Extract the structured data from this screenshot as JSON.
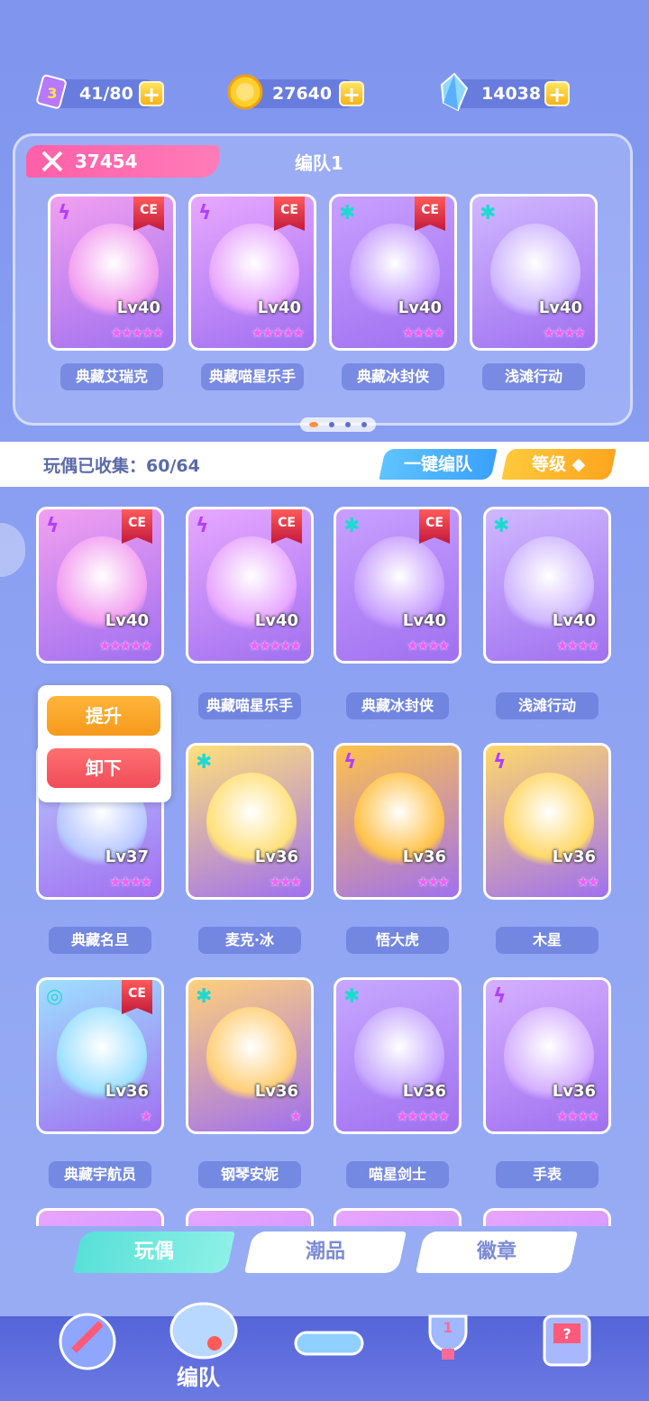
{
  "resources": [
    {
      "icon": "energy-icon",
      "value": "41/80"
    },
    {
      "icon": "coin-icon",
      "value": "27640"
    },
    {
      "icon": "crystal-icon",
      "value": "14038"
    }
  ],
  "team": {
    "power": "37454",
    "name": "编队1",
    "members": [
      {
        "name": "典藏艾瑞克",
        "level": "Lv40",
        "stars": "★★★★★",
        "element": "ϟ",
        "ce": "CE",
        "color": "#f2a0f0"
      },
      {
        "name": "典藏喵星乐手",
        "level": "Lv40",
        "stars": "★★★★★",
        "element": "ϟ",
        "ce": "CE",
        "color": "#e8a8ff"
      },
      {
        "name": "典藏冰封侠",
        "level": "Lv40",
        "stars": "★★★★",
        "element": "✱",
        "ce": "CE",
        "color": "#c8a0ff"
      },
      {
        "name": "浅滩行动",
        "level": "Lv40",
        "stars": "★★★★",
        "element": "✱",
        "ce": "",
        "color": "#d0b8ff"
      }
    ]
  },
  "collection": {
    "label": "玩偶已收集：60/64",
    "btn_quick": "一键编队",
    "btn_sort": "等级 ◆"
  },
  "dolls": [
    {
      "name": "",
      "level": "Lv40",
      "stars": "★★★★★",
      "element": "ϟ",
      "ce": "CE",
      "color": "#f2a0f0"
    },
    {
      "name": "典藏喵星乐手",
      "level": "Lv40",
      "stars": "★★★★★",
      "element": "ϟ",
      "ce": "CE",
      "color": "#e8a8ff"
    },
    {
      "name": "典藏冰封侠",
      "level": "Lv40",
      "stars": "★★★★",
      "element": "✱",
      "ce": "CE",
      "color": "#c8a0ff"
    },
    {
      "name": "浅滩行动",
      "level": "Lv40",
      "stars": "★★★★",
      "element": "✱",
      "ce": "",
      "color": "#d0b8ff"
    },
    {
      "name": "典藏名旦",
      "level": "Lv37",
      "stars": "★★★★",
      "element": "",
      "ce": "",
      "color": "#b8c8ff"
    },
    {
      "name": "麦克·冰",
      "level": "Lv36",
      "stars": "★★★",
      "element": "✱",
      "ce": "",
      "color": "#ffe07a"
    },
    {
      "name": "悟大虎",
      "level": "Lv36",
      "stars": "★★★",
      "element": "ϟ",
      "ce": "",
      "color": "#ffc24a"
    },
    {
      "name": "木星",
      "level": "Lv36",
      "stars": "★★",
      "element": "ϟ",
      "ce": "",
      "color": "#ffd86a"
    },
    {
      "name": "典藏宇航员",
      "level": "Lv36",
      "stars": "★",
      "element": "◎",
      "ce": "CE",
      "color": "#9ee0ff"
    },
    {
      "name": "钢琴安妮",
      "level": "Lv36",
      "stars": "★",
      "element": "✱",
      "ce": "",
      "color": "#ffd07a"
    },
    {
      "name": "喵星剑士",
      "level": "Lv36",
      "stars": "★★★★★",
      "element": "✱",
      "ce": "",
      "color": "#c7a8ff"
    },
    {
      "name": "手表",
      "level": "Lv36",
      "stars": "★★★★",
      "element": "ϟ",
      "ce": "",
      "color": "#d5b0ff"
    }
  ],
  "popup": {
    "upgrade": "提升",
    "unequip": "卸下"
  },
  "tabs": [
    "玩偶",
    "潮品",
    "徽章"
  ],
  "nav": {
    "active_label": "编队",
    "items": [
      "launch-icon",
      "team-icon",
      "gamepad-icon",
      "trophy-icon",
      "shop-icon"
    ]
  }
}
